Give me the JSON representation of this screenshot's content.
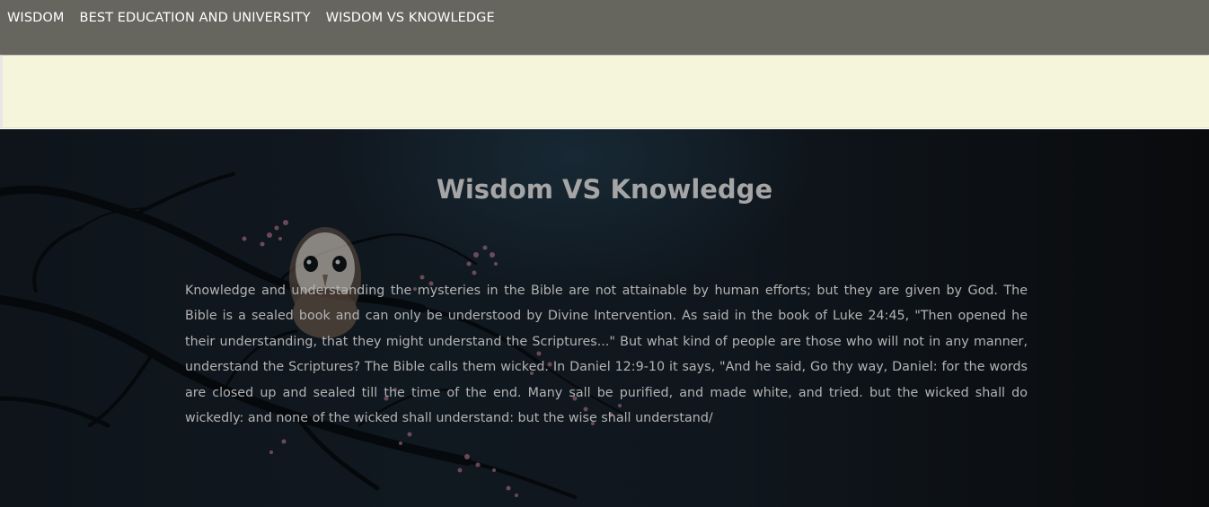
{
  "nav": {
    "items": [
      {
        "label": "WISDOM"
      },
      {
        "label": "BEST EDUCATION AND UNIVERSITY"
      },
      {
        "label": "WISDOM VS KNOWLEDGE"
      }
    ]
  },
  "hero": {
    "title": "Wisdom VS Knowledge",
    "paragraph": "Knowledge and understanding the mysteries in the Bible are not attainable by human efforts; but they are given by God. The Bible is a sealed book and can only be understood by Divine Intervention. As said in the book of Luke 24:45, \"Then opened he their understanding, that they might understand the Scriptures...\" But what kind of people are those who will not in any manner, understand the Scriptures? The Bible calls them wicked. In Daniel 12:9-10 it says, \"And he said, Go thy way, Daniel: for the words are closed up and sealed till the time of the end. Many sall be purified, and made white, and tried. but the wicked shall do wickedly: and none of the wicked shall understand: but the wise shall understand/",
    "background_image": "owl-on-blossom-branch"
  },
  "colors": {
    "topbar": "#67665e",
    "banner": "#f5f5dc",
    "hero_bg": "#0f161d",
    "title": "#a5a5a5",
    "text": "#b3b3b3",
    "blossom": "#8a5a6e"
  }
}
